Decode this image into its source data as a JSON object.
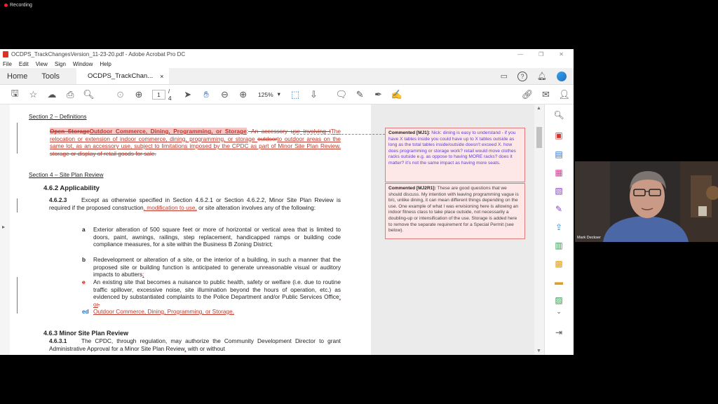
{
  "recording": {
    "label": "Recording"
  },
  "window": {
    "title": "OCDPS_TrackChangesVersion_11-23-20.pdf - Adobe Acrobat Pro DC",
    "menu": [
      "File",
      "Edit",
      "View",
      "Sign",
      "Window",
      "Help"
    ]
  },
  "tabs": {
    "home": "Home",
    "tools": "Tools",
    "doc": "OCDPS_TrackChan...",
    "close": "×"
  },
  "toolbar": {
    "page_current": "1",
    "page_total": "/ 4",
    "zoom": "125%"
  },
  "document": {
    "section2": "Section 2 – Definitions",
    "def_del_title": "Open Storage",
    "def_ins_title": "Outdoor Commerce, Dining, Programming, or Storage",
    "def_colon": ":",
    "def_del1": " An accessory use involving t",
    "def_ins1": "The",
    "def_ins2": " relocation or extension of indoor commerce, dining, programming, or storage ",
    "def_del2": "outdoor",
    "def_ins3": "to outdoor areas on the same lot, as an accessory use, subject to limitations imposed by the CPDC as part of Minor Site Plan Review.",
    "def_del3": " storage or display of retail goods for sale.",
    "section4": "Section 4 – Site Plan Review",
    "h462": "4.6.2  Applicability",
    "p4623_num": "4.6.2.3",
    "p4623_a": "Except as otherwise specified in Section 4.6.2.1 or Section 4.6.2.2, Minor Site Plan Review is required if the proposed construction",
    "p4623_ins": ", modification to use,",
    "p4623_b": " or site alteration involves any of the following:",
    "item_a_letter": "a",
    "item_a": "Exterior alteration of 500 square feet or more of horizontal or vertical area that is limited to doors, paint, awnings, railings, step replacement, handicapped ramps or building code compliance measures, for a site within the Business B Zoning District;",
    "item_b_letter": "b",
    "item_b": "Redevelopment or alteration of a site, or the interior of a building, in such a manner that the proposed site or building function is anticipated to generate unreasonable visual or auditory impacts to abutters",
    "item_b_ins": ";",
    "item_b_del": " ",
    "item_c_letter": "c",
    "item_c": "An existing site that becomes a nuisance to public health, safety or welfare (i.e. due to routine traffic spillover, excessive noise, site illumination beyond the hours of operation, etc.) as evidenced by substantiated complaints to the Police Department and/or Public Services Office",
    "item_c_ins": "; or",
    "item_c_del": ".",
    "item_d_letter": "ed",
    "item_d_ins": "Outdoor Commerce, Dining, Programming, or Storage.",
    "h463": "4.6.3  Minor Site Plan Review",
    "p4631_num": "4.6.3.1",
    "p4631": "The CPDC, through regulation, may authorize the Community Development Director to grant Administrative Approval for a Minor Site Plan Review",
    "p4631_ins": ",",
    "p4631_b": " with or without"
  },
  "comments": [
    {
      "who": "Commented [MJ1]:",
      "body": "Nick: dining is easy to understand - if you have X tables inside you could have up to X tables outside as long as the total tables inside/outside doesn't exceed X. how does programming or storage work? retail would move clothes racks outside e.g. as oppose to having MORE racks? does it matter? it's not the same impact as having more seats."
    },
    {
      "who": "Commented [MJ2R1]:",
      "body": "These are good questions that we should discuss. My intention with leaving programming vague is b/c, unlike dining, it can mean different things depending on the use. One example of what I was envisioning here is allowing an indoor fitness class to take place outside, not necessarily a doubling-up or intensification of the use. Storage is added here to remove the separate requirement for a Special Permit (see below)."
    }
  ],
  "video": {
    "participant": "Mark Deckser"
  },
  "colors": {
    "accent": "#1a6cc7",
    "track": "#c0392b",
    "comment_bg": "#fde7e7"
  }
}
